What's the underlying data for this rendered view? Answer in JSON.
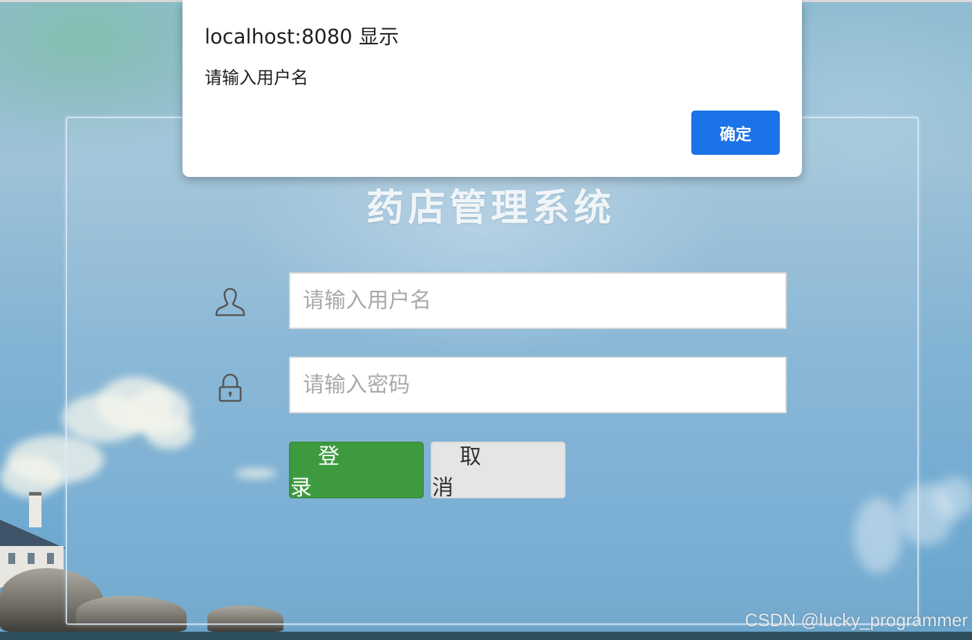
{
  "page": {
    "title": "药店管理系统"
  },
  "login_form": {
    "username": {
      "value": "",
      "placeholder": "请输入用户名",
      "icon": "user-icon"
    },
    "password": {
      "value": "",
      "placeholder": "请输入密码",
      "icon": "lock-icon"
    },
    "login_label": "登 录",
    "cancel_label": "取 消"
  },
  "alert_dialog": {
    "title": "localhost:8080 显示",
    "message": "请输入用户名",
    "ok_label": "确定"
  },
  "watermark": "CSDN @lucky_programmer",
  "colors": {
    "login_button": "#3d9a3f",
    "cancel_button": "#e5e5e5",
    "dialog_button": "#1a73e8",
    "background_sky": "#82b3d4"
  }
}
